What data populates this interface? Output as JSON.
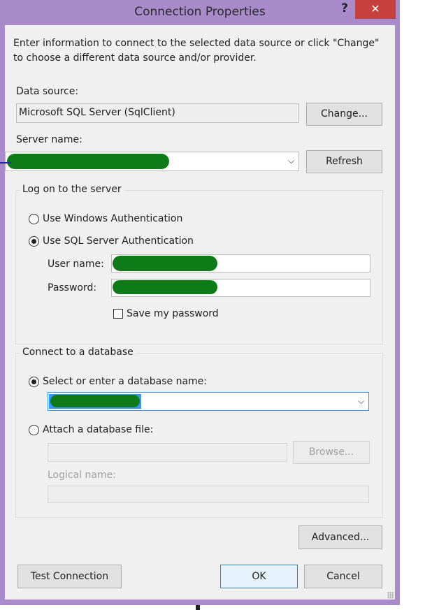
{
  "window": {
    "title": "Connection Properties",
    "help_label": "?",
    "close_label": "✕"
  },
  "intro": {
    "line1": "Enter information to connect to the selected data source or click \"Change\"",
    "line2": "to choose a different data source and/or provider."
  },
  "data_source": {
    "label": "Data source:",
    "value": "Microsoft SQL Server (SqlClient)",
    "change_label": "Change..."
  },
  "server": {
    "label": "Server name:",
    "value": "",
    "refresh_label": "Refresh"
  },
  "logon": {
    "legend": "Log on to the server",
    "windows_auth_label": "Use Windows Authentication",
    "sql_auth_label": "Use SQL Server Authentication",
    "selected": "sql",
    "user_label": "User name:",
    "user_value": "",
    "password_label": "Password:",
    "password_value": "",
    "save_password_label": "Save my password",
    "save_password_checked": false
  },
  "database": {
    "legend": "Connect to a database",
    "select_label": "Select or enter a database name:",
    "select_value": "",
    "attach_label": "Attach a database file:",
    "attach_value": "",
    "browse_label": "Browse...",
    "logical_label": "Logical name:",
    "logical_value": "",
    "selected": "select"
  },
  "buttons": {
    "advanced": "Advanced...",
    "test": "Test Connection",
    "ok": "OK",
    "cancel": "Cancel"
  },
  "colors": {
    "frame": "#a98bcc",
    "close": "#c7413c",
    "dialog_bg": "#f0f0f0",
    "redaction": "#0f7b18"
  }
}
